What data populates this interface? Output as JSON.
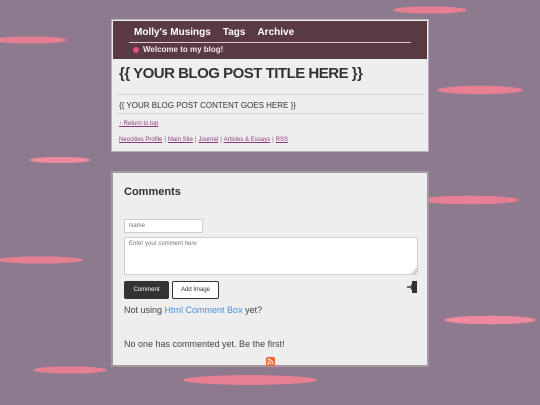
{
  "nav": {
    "links": [
      "Molly's Musings",
      "Tags",
      "Archive"
    ],
    "welcome": "Welcome to my blog!"
  },
  "post": {
    "title": "{{ YOUR BLOG POST TITLE HERE }}",
    "content": "{{ YOUR BLOG POST CONTENT GOES HERE }}",
    "return_top": "↑ Return to top"
  },
  "footer_links": [
    "Neocities Profile",
    "Main Site",
    "Journal",
    "Articles & Essays",
    "RSS"
  ],
  "comments": {
    "heading": "Comments",
    "name_placeholder": "Name",
    "comment_placeholder": "Enter your comment here",
    "comment_button": "Comment",
    "image_button": "Add Image",
    "promo_prefix": "Not using",
    "promo_link": "Html Comment Box",
    "promo_suffix": "yet?",
    "empty_message": "No one has commented yet. Be the first!"
  },
  "icons": {
    "welcome_dot": "bullet-dot-icon",
    "login": "login-icon",
    "rss": "rss-icon"
  },
  "colors": {
    "nav_bg": "#5a3a42",
    "link": "#8c3a7d",
    "accent_link": "#4a8fd9",
    "rss": "#f26522"
  }
}
